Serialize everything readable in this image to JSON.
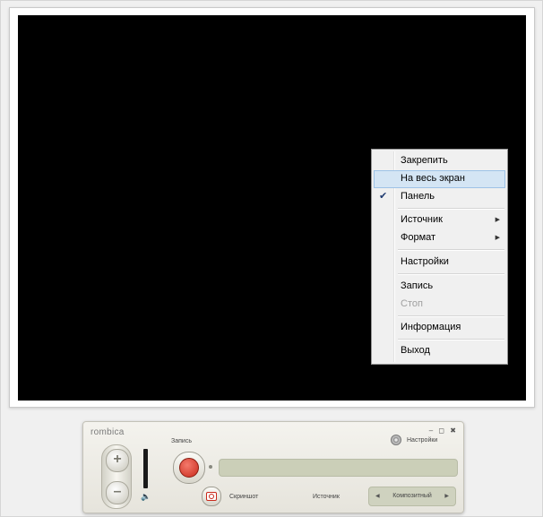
{
  "context_menu": {
    "items": [
      {
        "label": "Закрепить",
        "state": "normal"
      },
      {
        "label": "На весь экран",
        "state": "highlight"
      },
      {
        "label": "Панель",
        "state": "checked"
      },
      {
        "label": "Источник",
        "state": "submenu"
      },
      {
        "label": "Формат",
        "state": "submenu"
      },
      {
        "label": "Настройки",
        "state": "normal"
      },
      {
        "label": "Запись",
        "state": "normal"
      },
      {
        "label": "Стоп",
        "state": "disabled"
      },
      {
        "label": "Информация",
        "state": "normal"
      },
      {
        "label": "Выход",
        "state": "normal"
      }
    ],
    "check_glyph": "✔",
    "submenu_glyph": "▶"
  },
  "panel": {
    "brand": "rombica",
    "window_controls": "– ◻ ✖",
    "record_label": "Запись",
    "settings_label": "Настройки",
    "zoom_in": "+",
    "zoom_out": "–",
    "speaker_glyph": "🔈",
    "screenshot_label": "Скриншот",
    "source_label": "Источник",
    "source_value": "Композитный",
    "source_prev": "◀",
    "source_next": "▶"
  },
  "colors": {
    "video_background": "#000000",
    "menu_highlight": "#d4e5f4",
    "record_red": "#c92a1c",
    "track_green": "#cbcfb8"
  }
}
